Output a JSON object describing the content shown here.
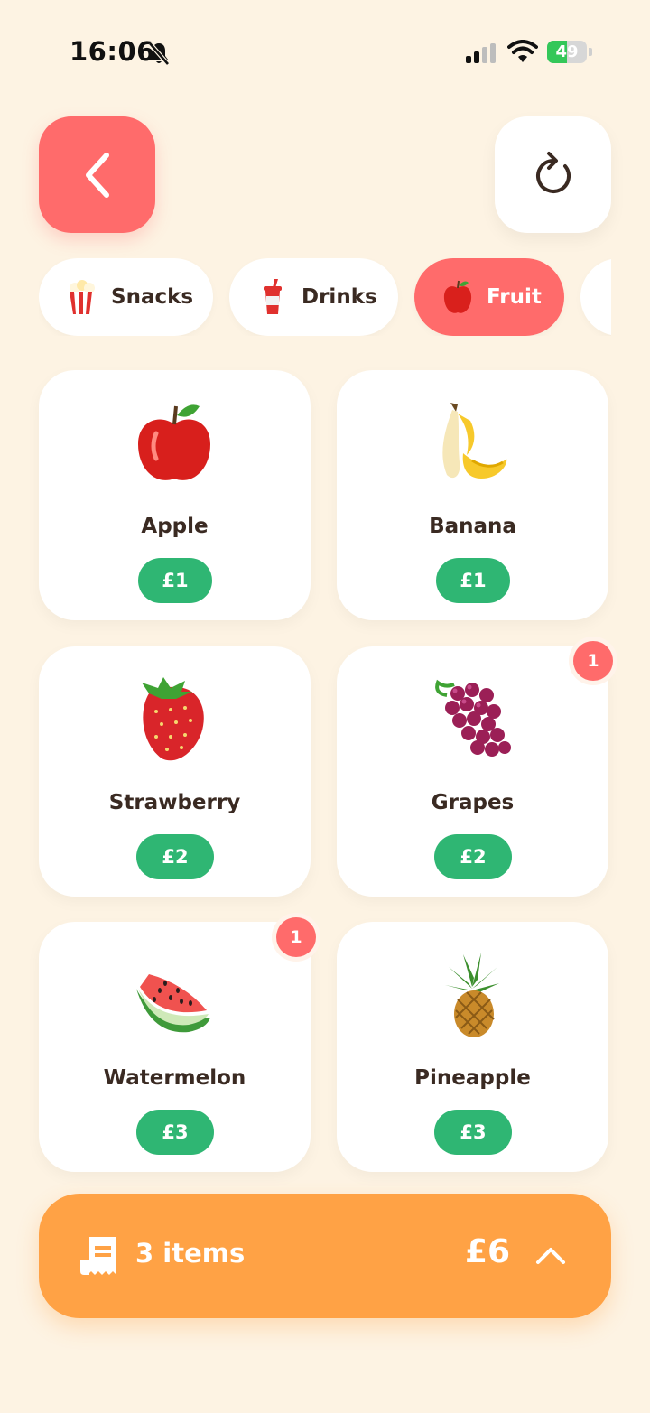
{
  "status_bar": {
    "time": "16:06",
    "battery_percent": "49",
    "battery_level": 0.49,
    "icons": [
      "bell-slash-icon",
      "cellular-signal-icon",
      "wifi-icon",
      "battery-charging-icon"
    ]
  },
  "header": {
    "back_icon": "chevron-left-icon",
    "reset_icon": "refresh-icon"
  },
  "categories": [
    {
      "label": "Snacks",
      "icon": "popcorn-icon",
      "active": false
    },
    {
      "label": "Drinks",
      "icon": "cup-with-straw-icon",
      "active": false
    },
    {
      "label": "Fruit",
      "icon": "red-apple-icon",
      "active": true
    }
  ],
  "products": [
    {
      "name": "Apple",
      "price": "£1",
      "icon": "apple-icon",
      "qty": ""
    },
    {
      "name": "Banana",
      "price": "£1",
      "icon": "banana-icon",
      "qty": ""
    },
    {
      "name": "Strawberry",
      "price": "£2",
      "icon": "strawberry-icon",
      "qty": ""
    },
    {
      "name": "Grapes",
      "price": "£2",
      "icon": "grapes-icon",
      "qty": "1"
    },
    {
      "name": "Watermelon",
      "price": "£3",
      "icon": "watermelon-icon",
      "qty": "1"
    },
    {
      "name": "Pineapple",
      "price": "£3",
      "icon": "pineapple-icon",
      "qty": ""
    }
  ],
  "cart": {
    "icon": "receipt-icon",
    "count_label": "3 items",
    "total": "£6",
    "expand_icon": "chevron-up-icon"
  },
  "colors": {
    "background": "#fdf3e3",
    "accent_red": "#ff6b6b",
    "price_green": "#2fb673",
    "cart_orange": "#ffa245"
  }
}
